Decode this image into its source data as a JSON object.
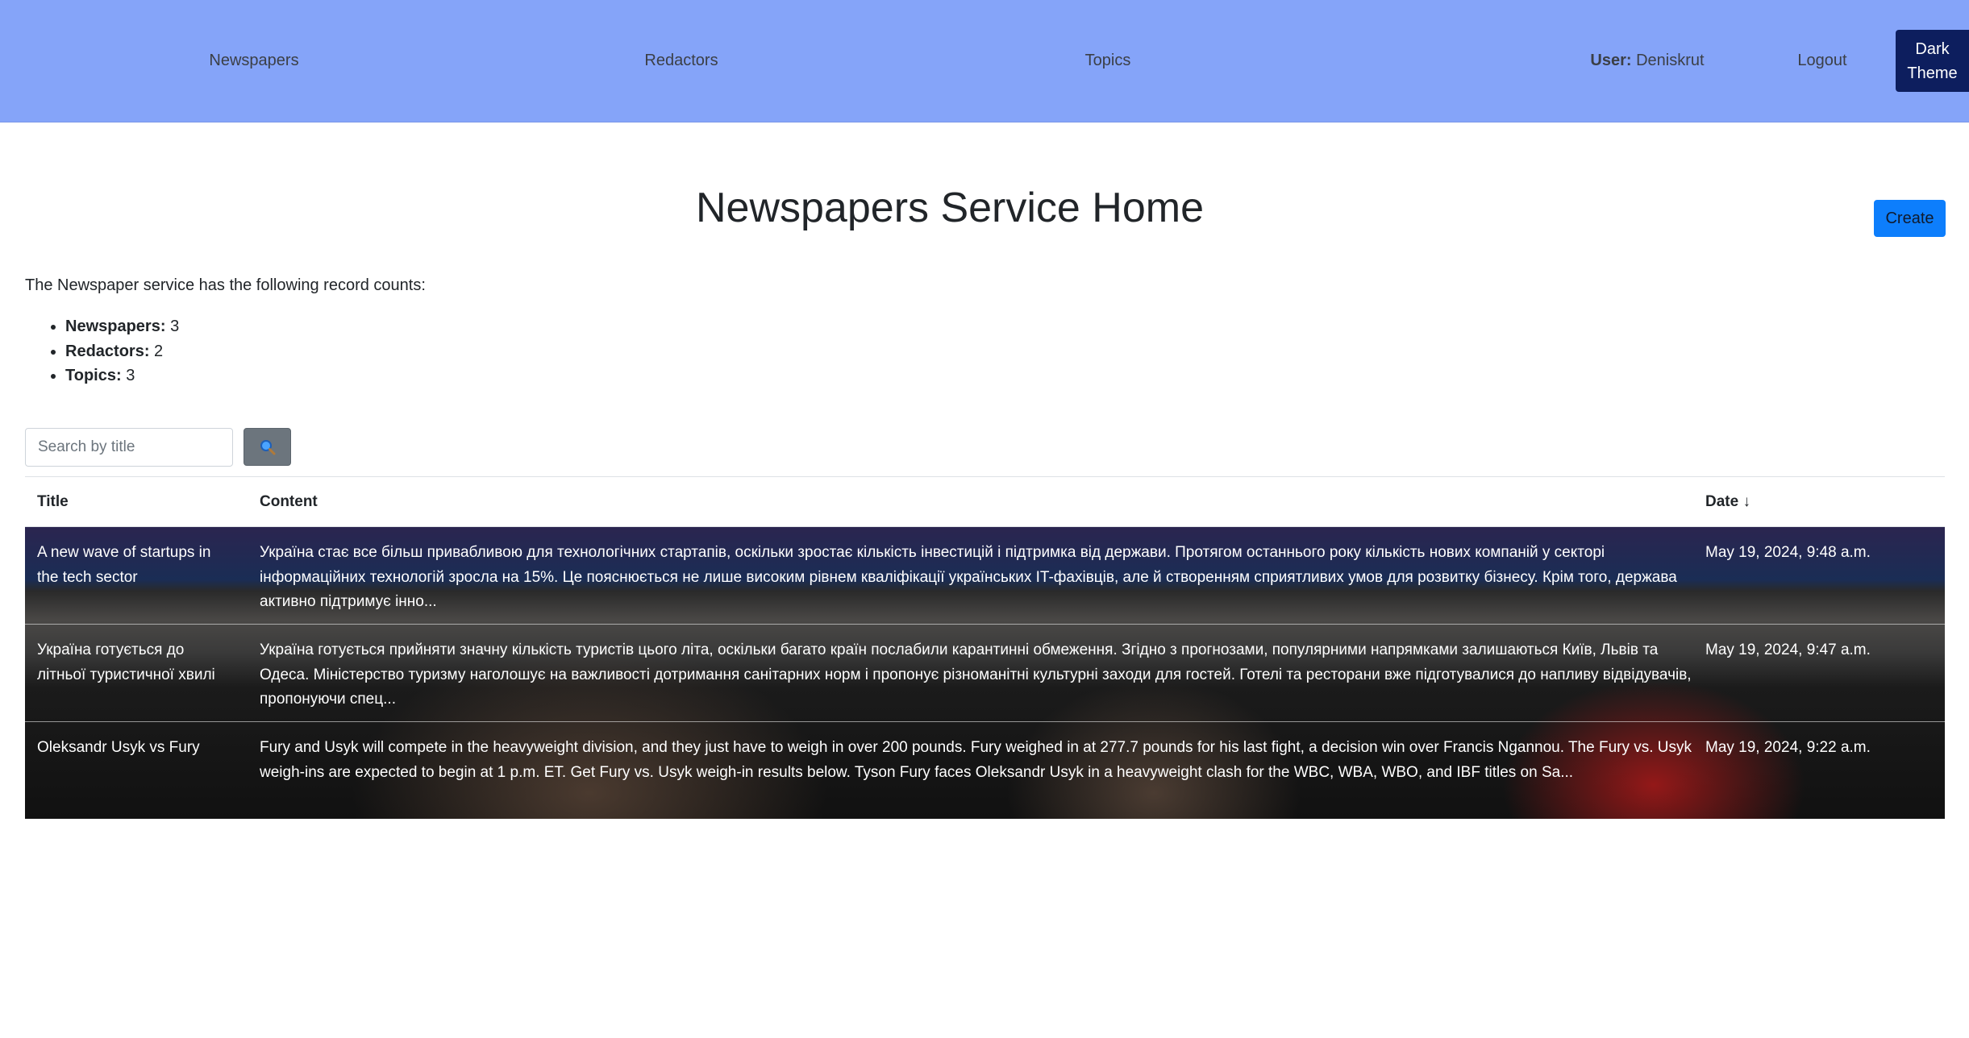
{
  "nav": {
    "newspapers": "Newspapers",
    "redactors": "Redactors",
    "topics": "Topics",
    "user_label": "User:",
    "username": "Deniskrut",
    "logout": "Logout",
    "dark_theme_line1": "Dark",
    "dark_theme_line2": "Theme"
  },
  "page": {
    "title": "Newspapers Service Home",
    "create_button": "Create",
    "intro": "The Newspaper service has the following record counts:"
  },
  "counts": [
    {
      "label": "Newspapers:",
      "value": "3"
    },
    {
      "label": "Redactors:",
      "value": "2"
    },
    {
      "label": "Topics:",
      "value": "3"
    }
  ],
  "search": {
    "placeholder": "Search by title",
    "button_icon": "search-icon"
  },
  "table": {
    "headers": {
      "title": "Title",
      "content": "Content",
      "date": "Date ↓"
    },
    "rows": [
      {
        "title": "A new wave of startups in the tech sector",
        "content": "Україна стає все більш привабливою для технологічних стартапів, оскільки зростає кількість інвестицій і підтримка від держави. Протягом останнього року кількість нових компаній у секторі інформаційних технологій зросла на 15%. Це пояснюється не лише високим рівнем кваліфікації українських IT-фахівців, але й створенням сприятливих умов для розвитку бізнесу. Крім того, держава активно підтримує інно...",
        "date": "May 19, 2024, 9:48 a.m."
      },
      {
        "title": "Україна готується до літньої туристичної хвилі",
        "content": "Україна готується прийняти значну кількість туристів цього літа, оскільки багато країн послабили карантинні обмеження. Згідно з прогнозами, популярними напрямками залишаються Київ, Львів та Одеса. Міністерство туризму наголошує на важливості дотримання санітарних норм і пропонує різноманітні культурні заходи для гостей. Готелі та ресторани вже підготувалися до напливу відвідувачів, пропонуючи спец...",
        "date": "May 19, 2024, 9:47 a.m."
      },
      {
        "title": "Oleksandr Usyk vs Fury",
        "content": "Fury and Usyk will compete in the heavyweight division, and they just have to weigh in over 200 pounds. Fury weighed in at 277.7 pounds for his last fight, a decision win over Francis Ngannou. The Fury vs. Usyk weigh-ins are expected to begin at 1 p.m. ET. Get Fury vs. Usyk weigh-in results below. Tyson Fury faces Oleksandr Usyk in a heavyweight clash for the WBC, WBA, WBO, and IBF titles on Sa...",
        "date": "May 19, 2024, 9:22 a.m."
      }
    ]
  },
  "colors": {
    "navbar": "#85a4f9",
    "dark_button": "#0d1e5e",
    "create_button": "#0d7efc",
    "search_button": "#6c757d"
  }
}
